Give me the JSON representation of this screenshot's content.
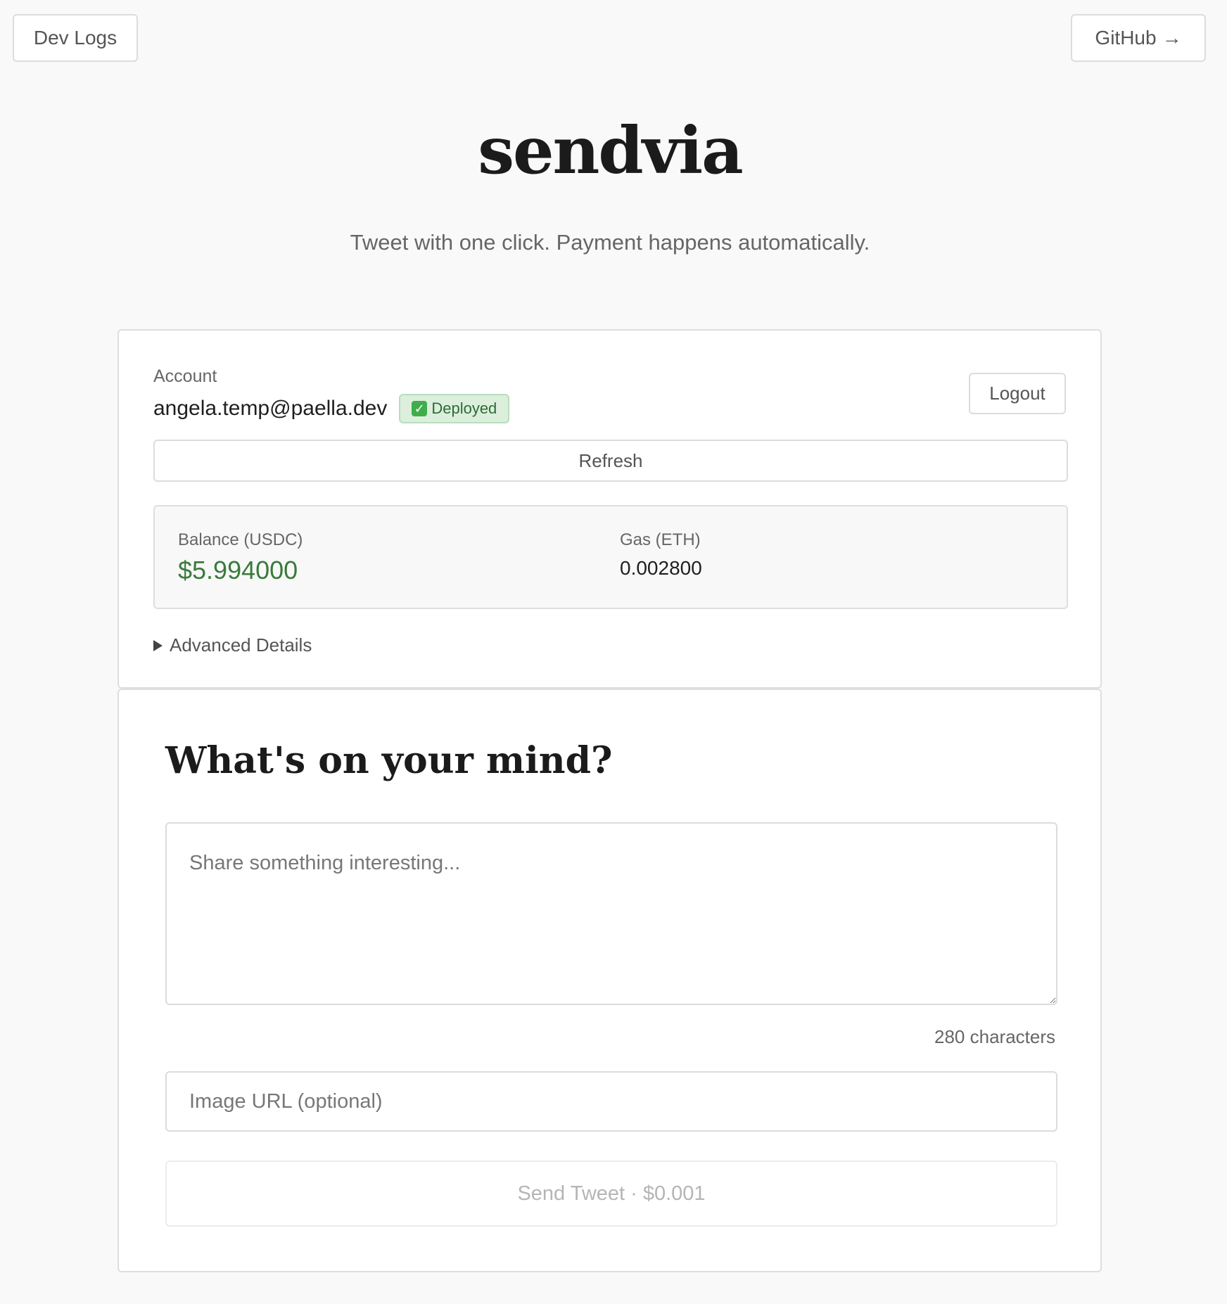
{
  "topbar": {
    "dev_logs_label": "Dev Logs",
    "github_label": "GitHub",
    "github_arrow": "→"
  },
  "header": {
    "brand": "sendvia",
    "tagline": "Tweet with one click. Payment happens automatically."
  },
  "account": {
    "label": "Account",
    "email": "angela.temp@paella.dev",
    "status_badge": "Deployed",
    "status_icon": "check-mark-icon",
    "logout_label": "Logout",
    "refresh_label": "Refresh",
    "balance_label": "Balance (USDC)",
    "balance_value": "$5.994000",
    "gas_label": "Gas (ETH)",
    "gas_value": "0.002800",
    "advanced_label": "Advanced Details"
  },
  "compose": {
    "title": "What's on your mind?",
    "tweet_placeholder": "Share something interesting...",
    "tweet_value": "",
    "char_count": "280 characters",
    "image_placeholder": "Image URL (optional)",
    "image_value": "",
    "send_label": "Send Tweet · $0.001"
  },
  "colors": {
    "background": "#f9f9f9",
    "card": "#ffffff",
    "balance_green": "#3a7a3c",
    "badge_bg": "#dbefdc",
    "badge_text": "#2e6b36",
    "disabled_text": "#b5b5b5"
  }
}
